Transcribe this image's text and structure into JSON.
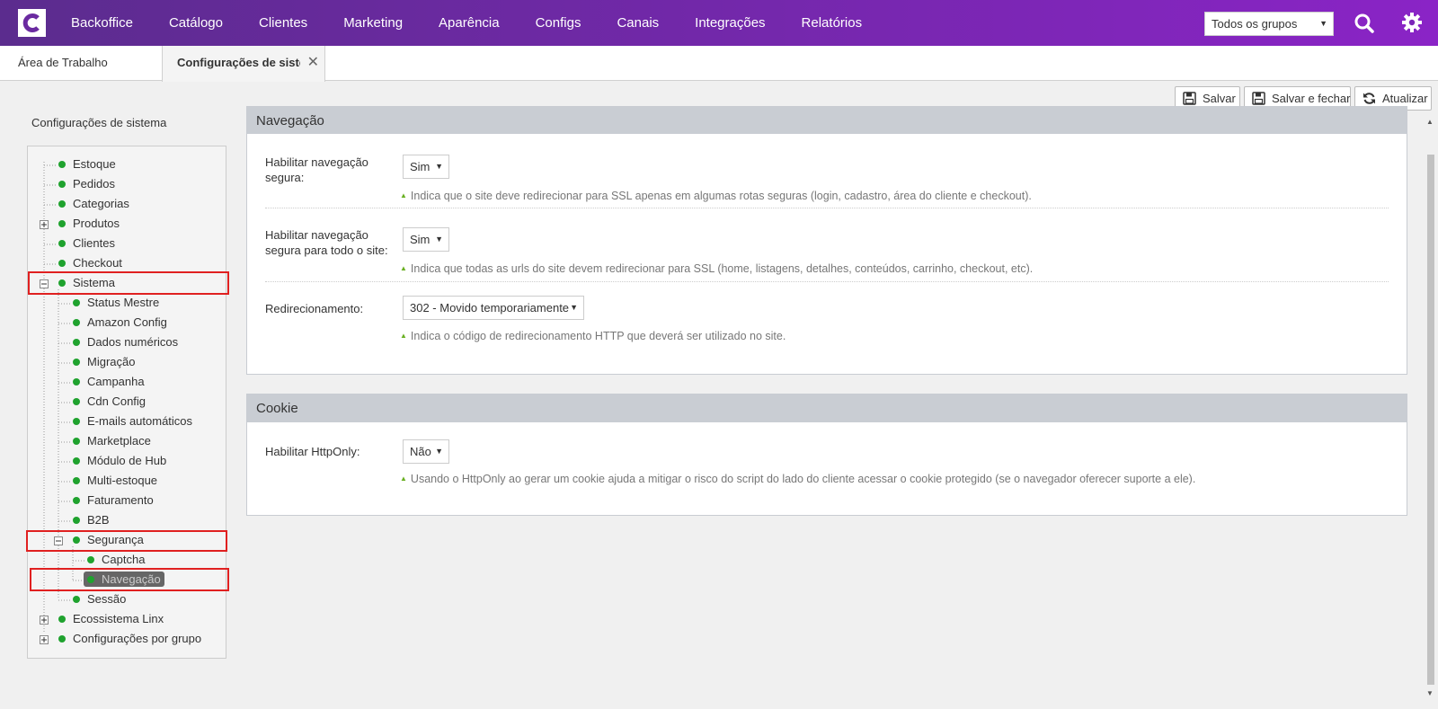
{
  "topbar": {
    "nav": [
      "Backoffice",
      "Catálogo",
      "Clientes",
      "Marketing",
      "Aparência",
      "Configs",
      "Canais",
      "Integrações",
      "Relatórios"
    ],
    "group_select_value": "Todos os grupos",
    "colors": {
      "gradient_start": "#5b2c8e",
      "gradient_end": "#8a24c6"
    }
  },
  "tabs": {
    "tab1_label": "Área de Trabalho",
    "tab2_label": "Configurações de sistema",
    "close_glyph": "✕"
  },
  "toolbar": {
    "save_label": "Salvar",
    "save_close_label": "Salvar e fechar",
    "refresh_label": "Atualizar"
  },
  "tree": {
    "title": "Configurações de sistema",
    "nodes": [
      "Estoque",
      "Pedidos",
      "Categorias",
      "Produtos",
      "Clientes",
      "Checkout",
      "Sistema",
      "Status Mestre",
      "Amazon Config",
      "Dados numéricos",
      "Migração",
      "Campanha",
      "Cdn Config",
      "E-mails automáticos",
      "Marketplace",
      "Módulo de Hub",
      "Multi-estoque",
      "Faturamento",
      "B2B",
      "Segurança",
      "Captcha",
      "Navegação",
      "Sessão",
      "Ecossistema Linx",
      "Configurações por grupo"
    ]
  },
  "navegacao": {
    "title": "Navegação",
    "rows": [
      {
        "label": "Habilitar navegação segura:",
        "value": "Sim",
        "hint": "Indica que o site deve redirecionar para SSL apenas em algumas rotas seguras (login, cadastro, área do cliente e checkout)."
      },
      {
        "label": "Habilitar navegação segura para todo o site:",
        "value": "Sim",
        "hint": "Indica que todas as urls do site devem redirecionar para SSL (home, listagens, detalhes, conteúdos, carrinho, checkout, etc)."
      },
      {
        "label": "Redirecionamento:",
        "value": "302 - Movido temporariamente",
        "hint": "Indica o código de redirecionamento HTTP que deverá ser utilizado no site."
      }
    ]
  },
  "cookie": {
    "title": "Cookie",
    "rows": [
      {
        "label": "Habilitar HttpOnly:",
        "value": "Não",
        "hint": "Usando o HttpOnly ao gerar um cookie ajuda a mitigar o risco do script do lado do cliente acessar o cookie protegido (se o navegador oferecer suporte a ele)."
      }
    ]
  }
}
